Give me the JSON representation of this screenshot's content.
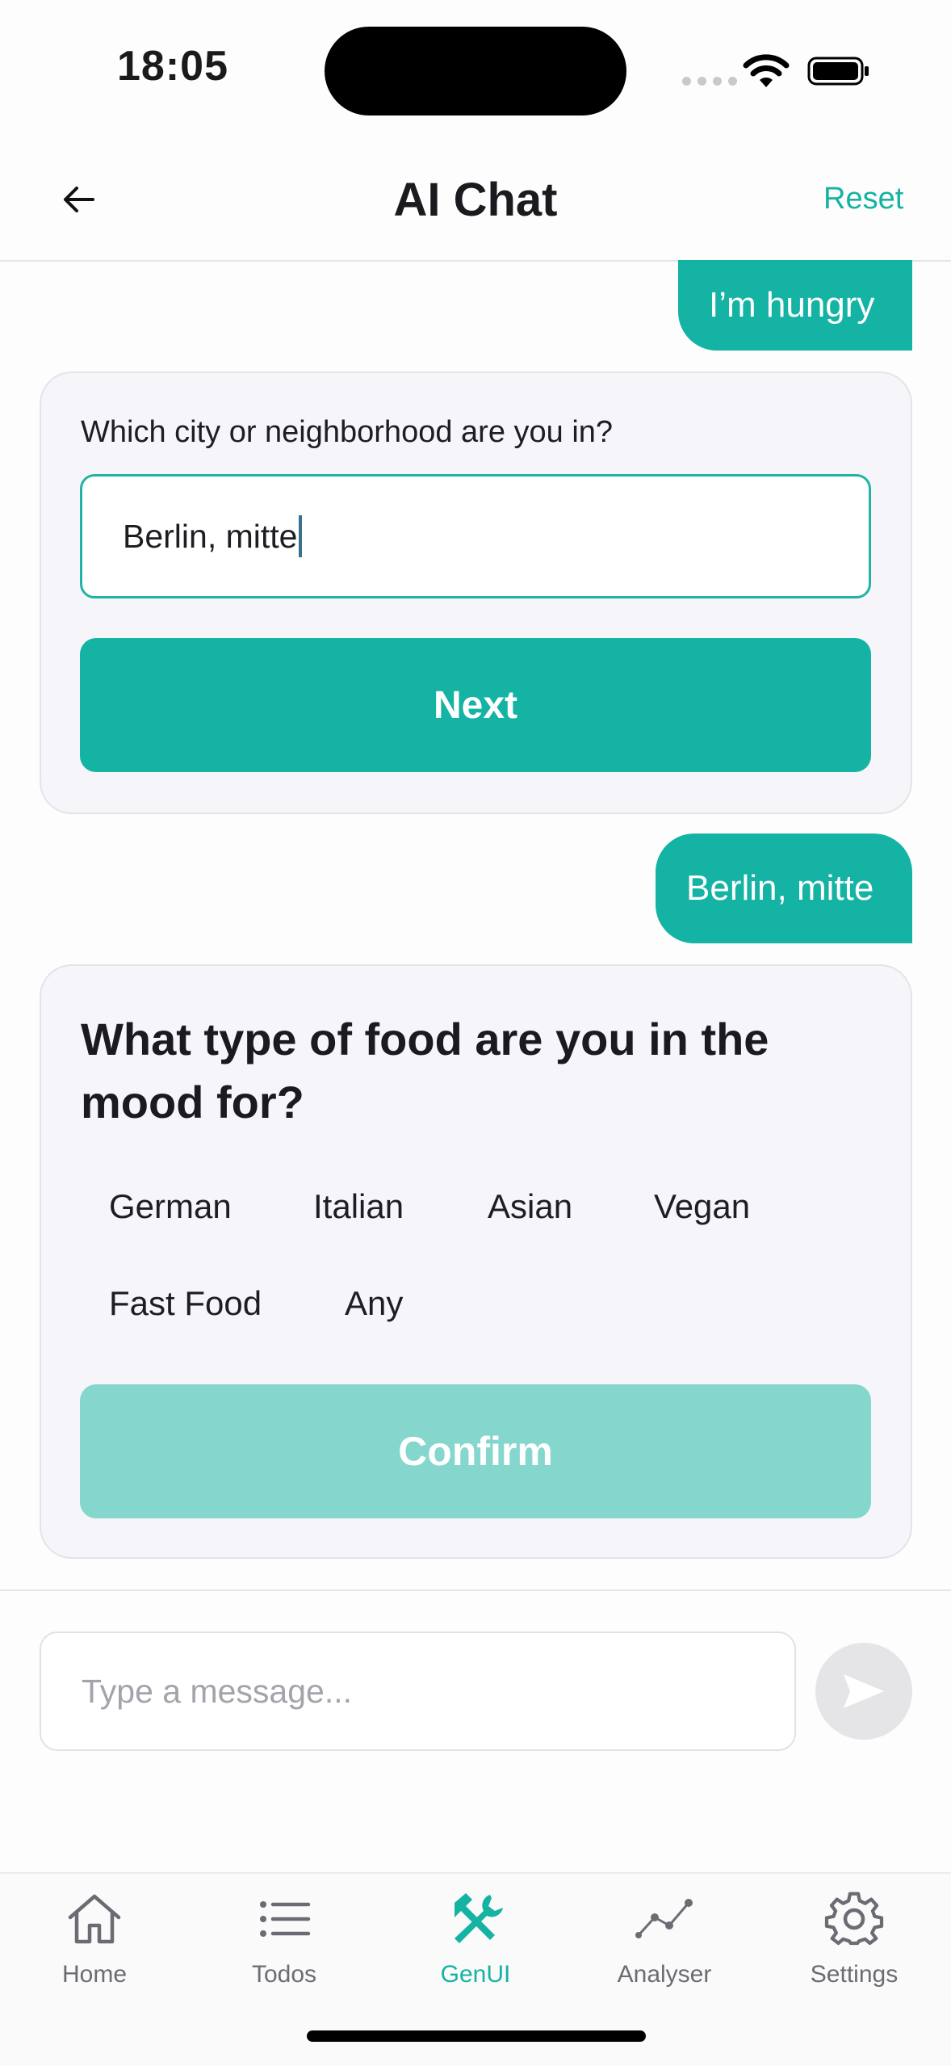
{
  "status_bar": {
    "time": "18:05"
  },
  "header": {
    "title": "AI Chat",
    "reset_label": "Reset"
  },
  "messages": [
    {
      "role": "user",
      "text": "I’m hungry"
    },
    {
      "role": "user",
      "text": "Berlin, mitte"
    }
  ],
  "location_card": {
    "question": "Which city or neighborhood are you in?",
    "input_value": "Berlin, mitte",
    "next_label": "Next"
  },
  "food_card": {
    "question": "What type of food are you in the mood for?",
    "options": [
      "German",
      "Italian",
      "Asian",
      "Vegan",
      "Fast Food",
      "Any"
    ],
    "confirm_label": "Confirm"
  },
  "composer": {
    "placeholder": "Type a message..."
  },
  "tabs": [
    {
      "label": "Home",
      "icon": "home-icon",
      "active": false
    },
    {
      "label": "Todos",
      "icon": "list-icon",
      "active": false
    },
    {
      "label": "GenUI",
      "icon": "tools-icon",
      "active": true
    },
    {
      "label": "Analyser",
      "icon": "chart-line-icon",
      "active": false
    },
    {
      "label": "Settings",
      "icon": "gear-icon",
      "active": false
    }
  ],
  "colors": {
    "accent": "#14b3a3",
    "accent_disabled": "#85d6cd",
    "card_bg": "#f6f6fa"
  }
}
